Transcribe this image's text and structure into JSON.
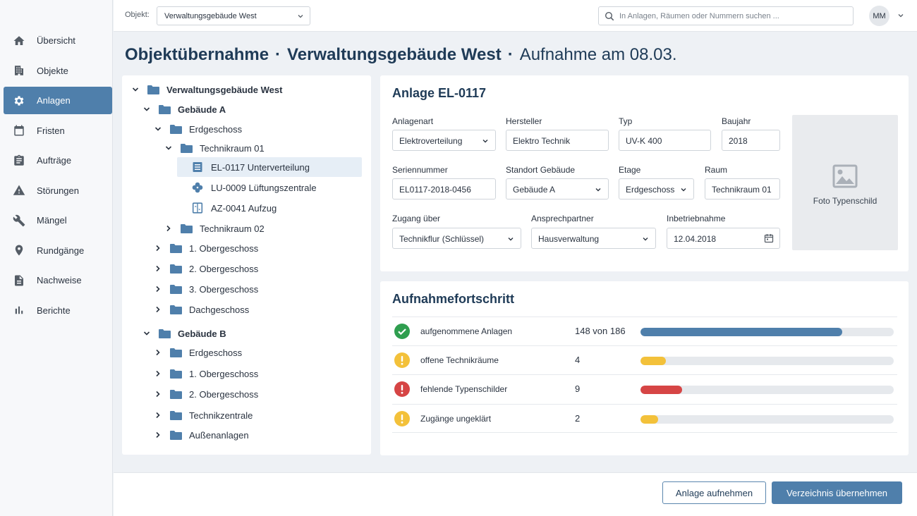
{
  "colors": {
    "accent": "#4f7fab",
    "folder": "#4f7fab",
    "bar_blue": "#4f7fab",
    "bar_yellow": "#f3c13a",
    "bar_red": "#d64545",
    "ok_green": "#2f9e4f"
  },
  "sidebar": {
    "items": [
      {
        "label": "Übersicht",
        "icon": "home-icon"
      },
      {
        "label": "Objekte",
        "icon": "building-icon"
      },
      {
        "label": "Anlagen",
        "icon": "gear-icon",
        "active": true
      },
      {
        "label": "Fristen",
        "icon": "calendar-icon"
      },
      {
        "label": "Aufträge",
        "icon": "clipboard-icon"
      },
      {
        "label": "Störungen",
        "icon": "warning-icon"
      },
      {
        "label": "Mängel",
        "icon": "wrench-icon"
      },
      {
        "label": "Rundgänge",
        "icon": "location-pin-icon"
      },
      {
        "label": "Nachweise",
        "icon": "document-icon"
      },
      {
        "label": "Berichte",
        "icon": "bar-chart-icon"
      }
    ]
  },
  "topbar": {
    "object_label": "Objekt:",
    "object_value": "Verwaltungsgebäude West",
    "search_placeholder": "In Anlagen, Räumen oder Nummern suchen ...",
    "avatar": "MM"
  },
  "title": {
    "part1": "Objektübernahme",
    "sep1": "·",
    "part2": "Verwaltungsgebäude West",
    "sep2": "·",
    "part3": "Aufnahme am 08.03."
  },
  "tree": [
    {
      "label": "Verwaltungsgebäude West"
    },
    {
      "label": "Gebäude A"
    },
    {
      "label": "Erdgeschoss"
    },
    {
      "label": "Technikraum 01"
    },
    {
      "label": "EL-0117 Unterverteilung"
    },
    {
      "label": "LU-0009 Lüftungszentrale"
    },
    {
      "label": "AZ-0041 Aufzug"
    },
    {
      "label": "Technikraum 02"
    },
    {
      "label": "1. Obergeschoss"
    },
    {
      "label": "2. Obergeschoss"
    },
    {
      "label": "3. Obergeschoss"
    },
    {
      "label": "Dachgeschoss"
    },
    {
      "label": "Gebäude B"
    },
    {
      "label": "Erdgeschoss"
    },
    {
      "label": "1. Obergeschoss"
    },
    {
      "label": "2. Obergeschoss"
    },
    {
      "label": "Technikzentrale"
    },
    {
      "label": "Außenanlagen"
    }
  ],
  "detail": {
    "title": "Anlage EL-0117",
    "fields": {
      "anlagenart": {
        "label": "Anlagenart",
        "value": "Elektroverteilung"
      },
      "hersteller": {
        "label": "Hersteller",
        "value": "Elektro Technik"
      },
      "typ": {
        "label": "Typ",
        "value": "UV-K 400"
      },
      "baujahr": {
        "label": "Baujahr",
        "value": "2018"
      },
      "seriennummer": {
        "label": "Seriennummer",
        "value": "EL0117-2018-0456"
      },
      "standort": {
        "label": "Standort Gebäude",
        "value": "Gebäude A"
      },
      "etage": {
        "label": "Etage",
        "value": "Erdgeschoss"
      },
      "raum": {
        "label": "Raum",
        "value": "Technikraum 01"
      },
      "zugang": {
        "label": "Zugang über",
        "value": "Technikflur (Schlüssel)"
      },
      "ansprechpartner": {
        "label": "Ansprechpartner",
        "value": "Hausverwaltung"
      },
      "inbetriebnahme": {
        "label": "Inbetriebnahme",
        "value": "12.04.2018"
      }
    },
    "photo_caption": "Foto Typenschild"
  },
  "progress": {
    "title": "Aufnahmefortschritt",
    "rows": [
      {
        "label": "aufgenommene Anlagen",
        "value": "148 von 186",
        "fraction": 0.796,
        "status": "ok",
        "color": "#4f7fab"
      },
      {
        "label": "offene Technikräume",
        "value": "4",
        "fraction": 0.1,
        "status": "warning",
        "color": "#f3c13a"
      },
      {
        "label": "fehlende Typenschilder",
        "value": "9",
        "fraction": 0.165,
        "status": "error",
        "color": "#d64545"
      },
      {
        "label": "Zugänge ungeklärt",
        "value": "2",
        "fraction": 0.07,
        "status": "warning",
        "color": "#f3c13a"
      }
    ]
  },
  "footer": {
    "secondary": "Anlage aufnehmen",
    "primary": "Verzeichnis übernehmen"
  }
}
